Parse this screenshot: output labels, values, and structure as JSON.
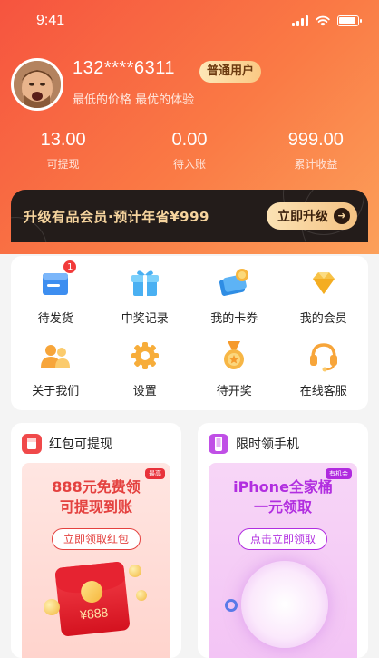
{
  "status_bar": {
    "time": "9:41"
  },
  "profile": {
    "phone": "132****6311",
    "level": "普通用户",
    "slogan": "最低的价格 最优的体验"
  },
  "stats": [
    {
      "value": "13.00",
      "label": "可提现"
    },
    {
      "value": "0.00",
      "label": "待入账"
    },
    {
      "value": "999.00",
      "label": "累计收益"
    }
  ],
  "vip": {
    "text": "升级有品会员·预计年省¥999",
    "button": "立即升级"
  },
  "menu": [
    {
      "label": "待发货",
      "icon": "pending-shipment-icon",
      "badge": "1"
    },
    {
      "label": "中奖记录",
      "icon": "gift-icon"
    },
    {
      "label": "我的卡券",
      "icon": "coupon-icon"
    },
    {
      "label": "我的会员",
      "icon": "diamond-icon"
    },
    {
      "label": "关于我们",
      "icon": "users-icon"
    },
    {
      "label": "设置",
      "icon": "gear-icon"
    },
    {
      "label": "待开奖",
      "icon": "medal-icon"
    },
    {
      "label": "在线客服",
      "icon": "headset-icon"
    }
  ],
  "promos": {
    "left": {
      "title": "红包可提现",
      "tag": "最高",
      "headline_line1": "888元免费领",
      "headline_line2": "可提现到账",
      "button": "立即领取红包",
      "amount": "¥888"
    },
    "right": {
      "title": "限时领手机",
      "tag": "有机会",
      "headline_line1": "iPhone全家桶",
      "headline_line2": "一元领取",
      "button": "点击立即领取"
    }
  },
  "colors": {
    "hero_start": "#f6543f",
    "hero_end": "#fca05a",
    "vip_bg": "#231c1a",
    "vip_gold": "#f6d49e",
    "red": "#e4413f",
    "purple": "#b12ee0"
  }
}
